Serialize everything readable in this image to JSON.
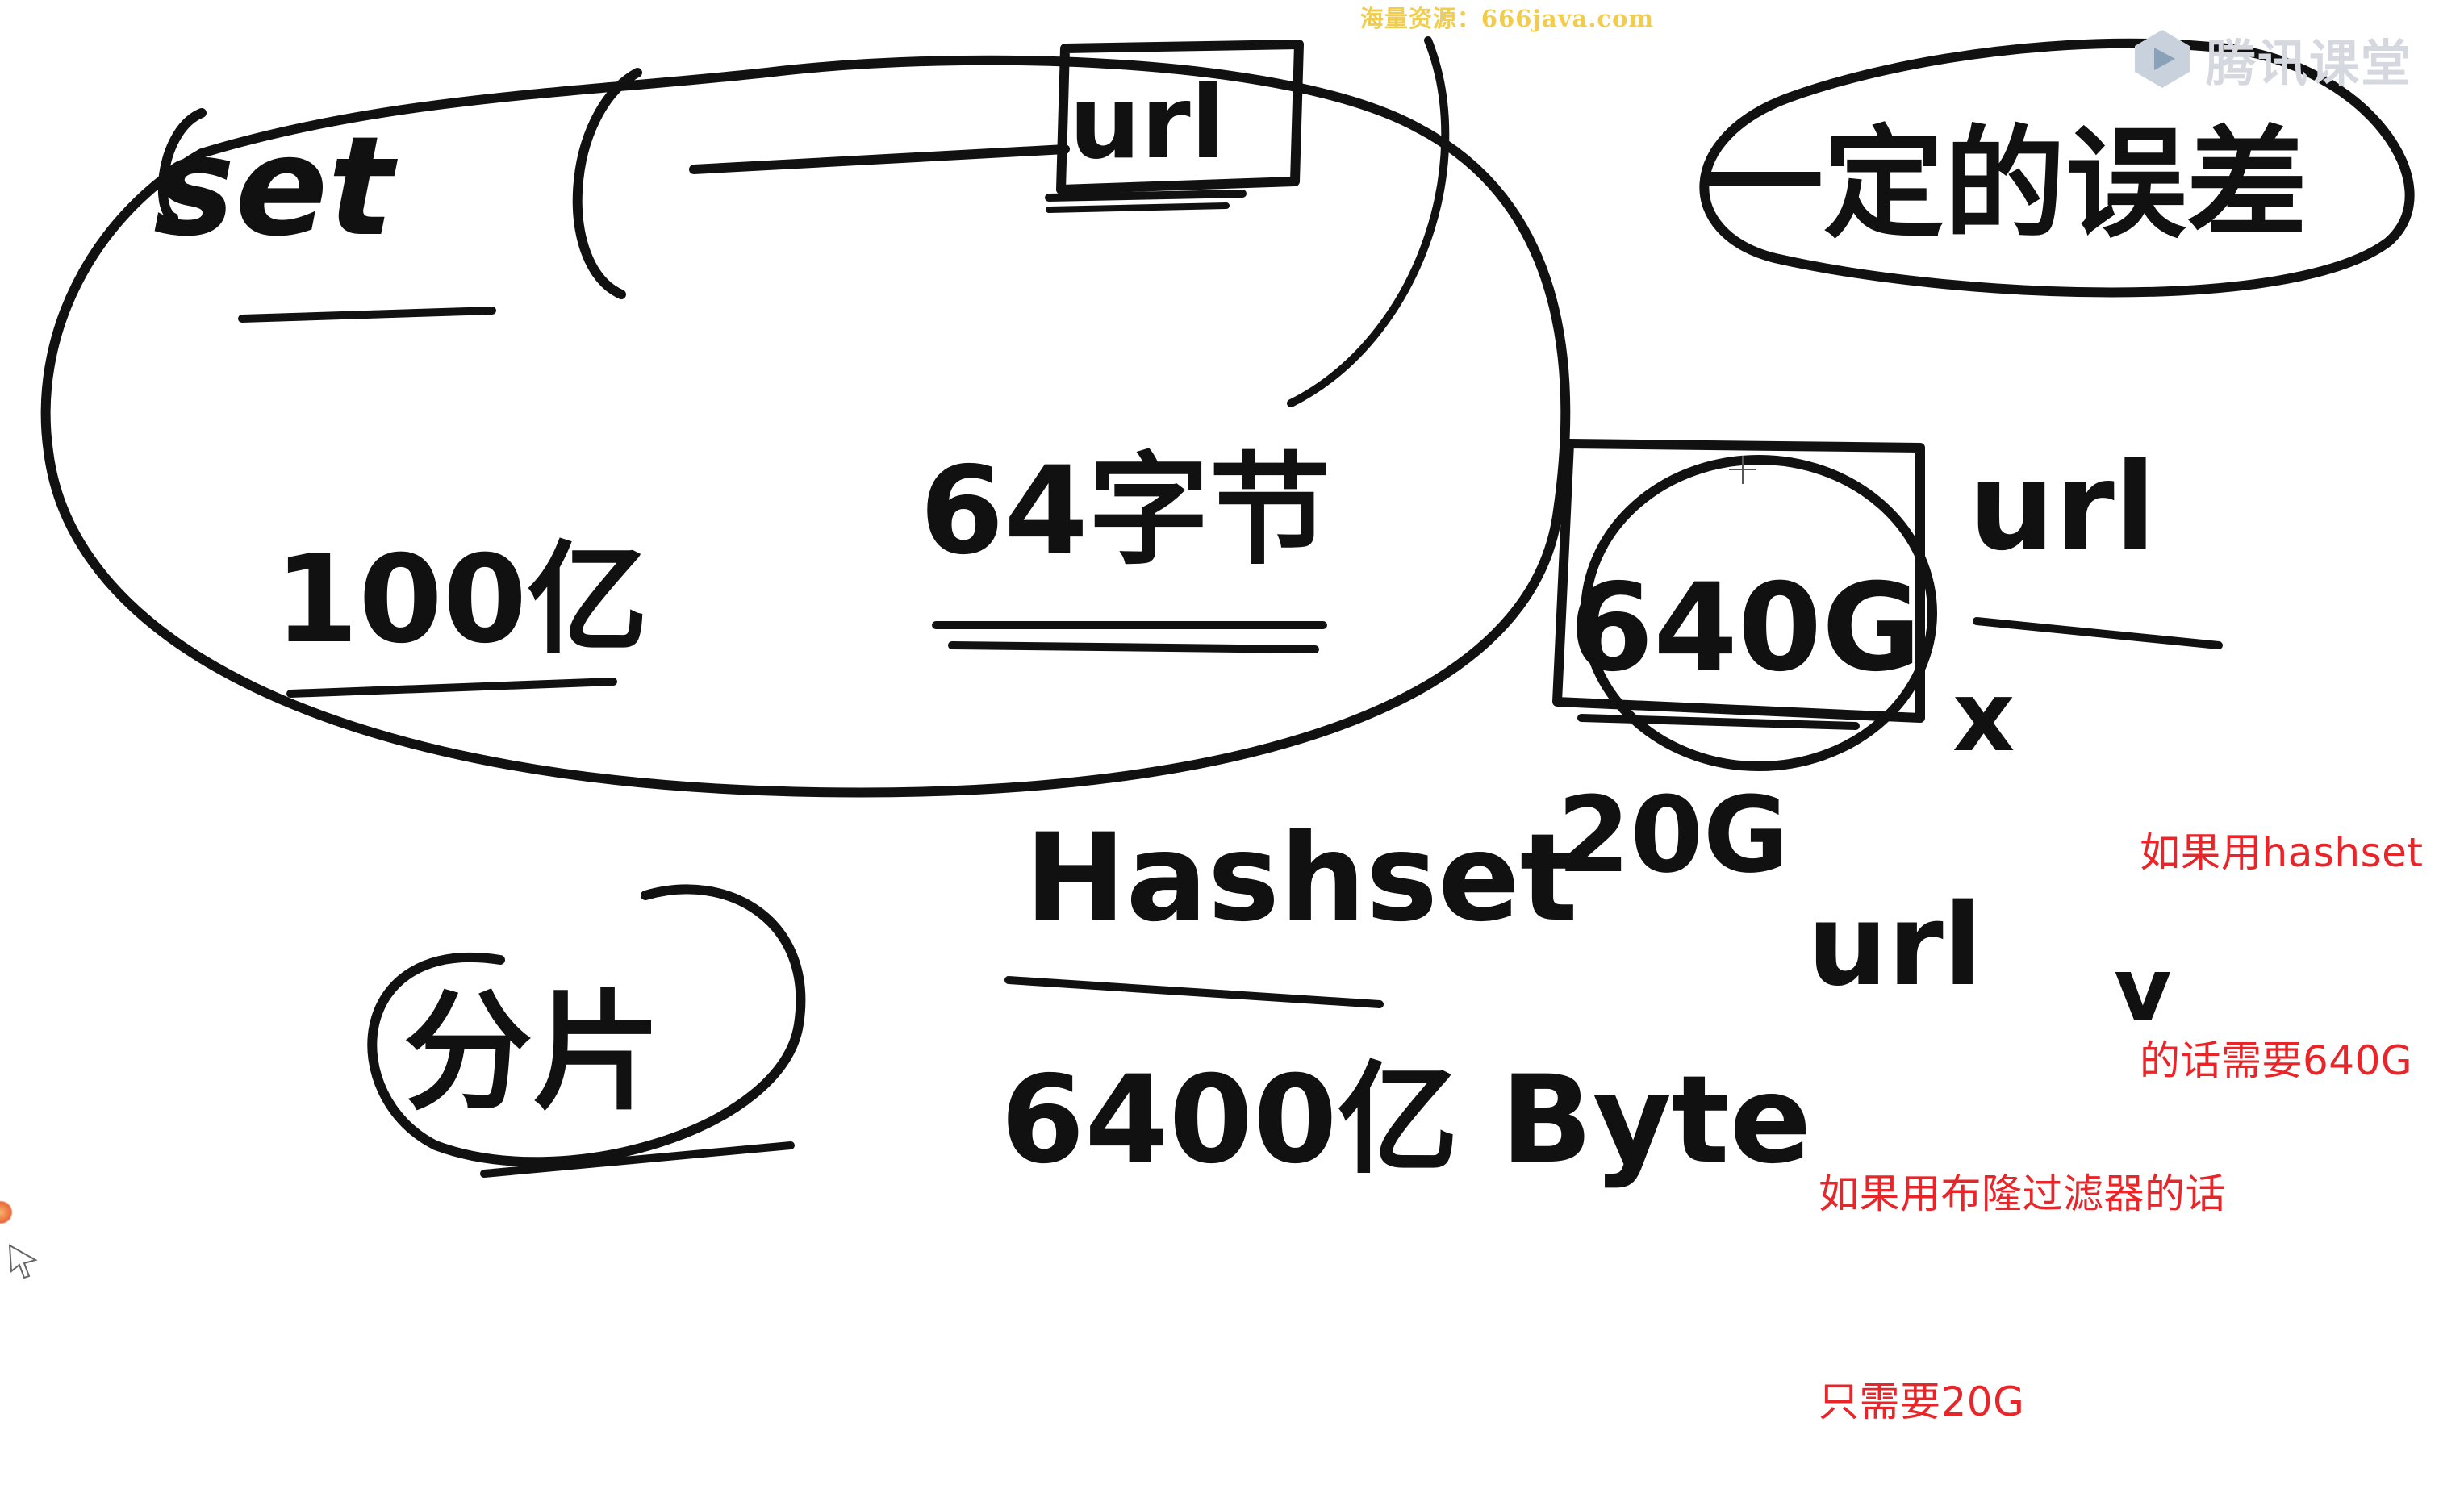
{
  "watermark": "海量资源：666java.com",
  "brand": {
    "name": "腾讯课堂",
    "icon": "play-triangle-icon",
    "color": "#d5d9df"
  },
  "handwriting": {
    "set": "set",
    "url_box": "url",
    "count_100": "100亿",
    "bytes_64": "64字节",
    "error_rate": "一定的误差",
    "size_640g": "640G",
    "url_right_top": "url",
    "hashset": "Hashset",
    "size_20g": "20G",
    "url_right_bottom": "url",
    "split": "分片",
    "bytes_6400": "6400亿 Byte",
    "mark_cross": "x",
    "mark_check": "v"
  },
  "notes": {
    "hashset_note": [
      "如果用hashset",
      "的话需要640G"
    ],
    "bloom_note": [
      "如果用布隆过滤器的话",
      "只需要20G"
    ],
    "color": "#e8262a"
  },
  "ink_color": "#111111"
}
